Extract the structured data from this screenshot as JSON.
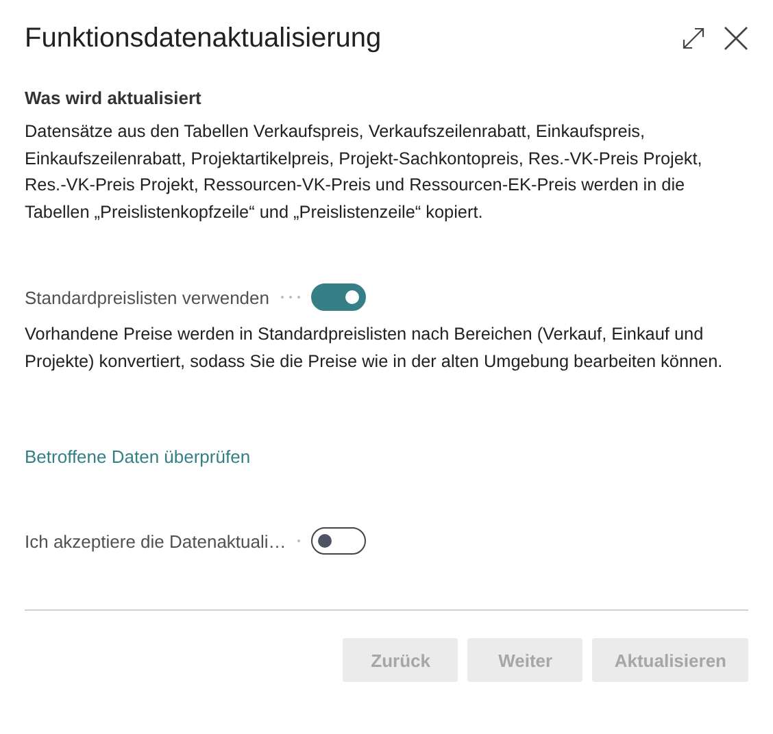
{
  "dialog": {
    "title": "Funktionsdatenaktualisierung"
  },
  "section": {
    "heading": "Was wird aktualisiert",
    "text": "Datensätze aus den Tabellen Verkaufspreis, Verkaufszeilenrabatt, Einkaufspreis, Einkaufszeilenrabatt, Projektartikelpreis, Projekt-Sachkontopreis, Res.-VK-Preis Projekt, Res.-VK-Preis Projekt, Ressourcen-VK-Preis und Ressourcen-EK-Preis werden in die Tabellen „Preislistenkopfzeile“ und „Preislistenzeile“ kopiert."
  },
  "option": {
    "label": "Standardpreislisten verwenden",
    "on": true,
    "description": "Vorhandene Preise werden in Standardpreislisten nach Bereichen (Verkauf, Einkauf und Projekte) konvertiert, sodass Sie die Preise wie in der alten Umgebung bearbeiten können."
  },
  "link": "Betroffene Daten überprüfen",
  "accept": {
    "label": "Ich akzeptiere die Datenaktuali…",
    "on": false
  },
  "buttons": [
    {
      "label": "Zurück",
      "disabled": true
    },
    {
      "label": "Weiter",
      "disabled": true
    },
    {
      "label": "Aktualisieren",
      "disabled": true
    }
  ]
}
